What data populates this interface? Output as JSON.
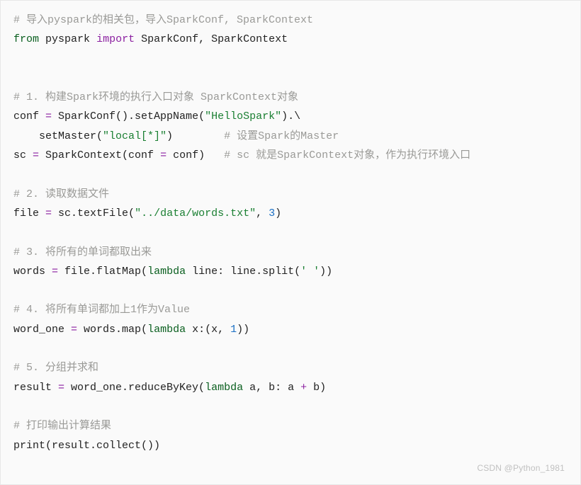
{
  "code": {
    "l01": {
      "comment": "# 导入pyspark的相关包，导入SparkConf, SparkContext"
    },
    "l02": {
      "kw_from": "from",
      "mod": "pyspark",
      "kw_import": "import",
      "names": "SparkConf, SparkContext"
    },
    "l05": {
      "comment": "# 1. 构建Spark环境的执行入口对象 SparkContext对象"
    },
    "l06": {
      "lhs": "conf ",
      "eq": "=",
      "sp": " SparkConf().setAppName(",
      "str": "\"HelloSpark\"",
      "tail": ").\\"
    },
    "l07": {
      "indent": "    setMaster(",
      "str": "\"local[*]\"",
      "close": ")        ",
      "comment": "# 设置Spark的Master"
    },
    "l08": {
      "lhs": "sc ",
      "eq": "=",
      "sp": " SparkContext(conf ",
      "eq2": "=",
      "sp2": " conf)   ",
      "comment": "# sc 就是SparkContext对象，作为执行环境入口"
    },
    "l10": {
      "comment": "# 2. 读取数据文件"
    },
    "l11": {
      "lhs": "file ",
      "eq": "=",
      "sp": " sc.textFile(",
      "str": "\"../data/words.txt\"",
      "comma": ", ",
      "num": "3",
      "close": ")"
    },
    "l13": {
      "comment": "# 3. 将所有的单词都取出来"
    },
    "l14": {
      "lhs": "words ",
      "eq": "=",
      "sp": " file.flatMap(",
      "lam": "lambda",
      "args": " line: line.split(",
      "str": "' '",
      "close": "))"
    },
    "l16": {
      "comment": "# 4. 将所有单词都加上1作为Value"
    },
    "l17": {
      "lhs": "word_one ",
      "eq": "=",
      "sp": " words.map(",
      "lam": "lambda",
      "args": " x:(x, ",
      "num": "1",
      "close": "))"
    },
    "l19": {
      "comment": "# 5. 分组并求和"
    },
    "l20": {
      "lhs": "result ",
      "eq": "=",
      "sp": " word_one.reduceByKey(",
      "lam": "lambda",
      "args": " a, b: a ",
      "plus": "+",
      "args2": " b)"
    },
    "l22": {
      "comment": "# 打印输出计算结果"
    },
    "l23": {
      "call": "print",
      "open": "(result.collect())"
    }
  },
  "watermark": "CSDN @Python_1981"
}
